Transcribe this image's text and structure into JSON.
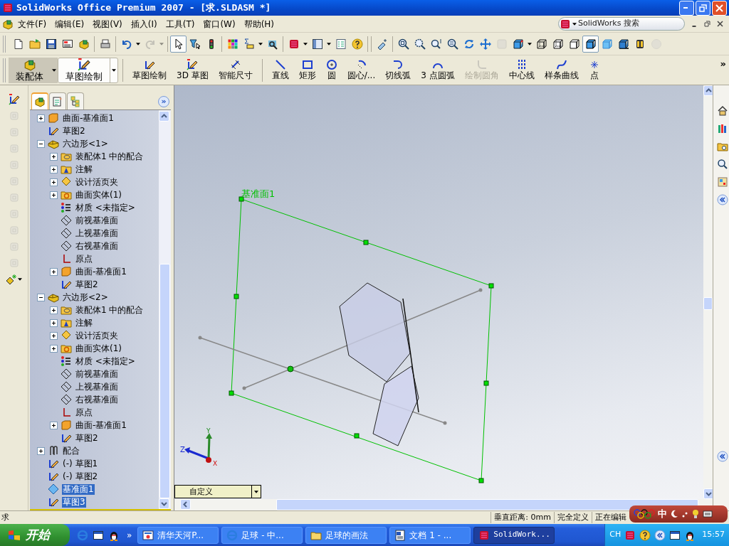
{
  "window": {
    "title": "SolidWorks Office Premium 2007 - [求.SLDASM *]"
  },
  "menu": [
    {
      "label": "文件(F)"
    },
    {
      "label": "编辑(E)"
    },
    {
      "label": "视图(V)"
    },
    {
      "label": "插入(I)"
    },
    {
      "label": "工具(T)"
    },
    {
      "label": "窗口(W)"
    },
    {
      "label": "帮助(H)"
    }
  ],
  "search": {
    "placeholder": "SolidWorks 搜索"
  },
  "toolbar": {
    "groups": [
      {
        "items": [
          {
            "kind": "new",
            "selected": false,
            "disabled": false
          },
          {
            "kind": "open",
            "selected": false,
            "disabled": false
          },
          {
            "kind": "save",
            "selected": false,
            "disabled": false
          },
          {
            "kind": "drawing",
            "selected": false,
            "disabled": false
          },
          {
            "kind": "assembly",
            "selected": false,
            "disabled": false
          }
        ]
      },
      {
        "items": [
          {
            "kind": "print",
            "selected": false,
            "disabled": false
          }
        ]
      },
      {
        "items": [
          {
            "kind": "undo",
            "selected": false,
            "disabled": false
          },
          {
            "kind": "caret",
            "selected": false,
            "disabled": false
          },
          {
            "kind": "redo",
            "selected": false,
            "disabled": true
          },
          {
            "kind": "caret",
            "selected": false,
            "disabled": true
          }
        ]
      },
      {
        "items": [
          {
            "kind": "select",
            "selected": true,
            "disabled": false
          },
          {
            "kind": "filter",
            "selected": false,
            "disabled": false
          },
          {
            "kind": "traffic",
            "selected": false,
            "disabled": false
          }
        ]
      },
      {
        "items": [
          {
            "kind": "palette",
            "selected": false,
            "disabled": false
          },
          {
            "kind": "equation",
            "selected": false,
            "disabled": false
          },
          {
            "kind": "caret",
            "selected": false,
            "disabled": false
          },
          {
            "kind": "sensor",
            "selected": false,
            "disabled": false
          }
        ]
      },
      {
        "items": [
          {
            "kind": "swlogo",
            "selected": false,
            "disabled": false
          },
          {
            "kind": "caret",
            "selected": false,
            "disabled": false
          },
          {
            "kind": "layout",
            "selected": false,
            "disabled": false
          },
          {
            "kind": "caret",
            "selected": false,
            "disabled": false
          },
          {
            "kind": "options",
            "selected": false,
            "disabled": false
          },
          {
            "kind": "help",
            "selected": false,
            "disabled": false
          }
        ]
      },
      {
        "items": [
          {
            "kind": "viewtool",
            "selected": false,
            "disabled": false
          }
        ]
      },
      {
        "items": [
          {
            "kind": "zoomfit",
            "selected": false,
            "disabled": false
          },
          {
            "kind": "zoomarea",
            "selected": false,
            "disabled": false
          },
          {
            "kind": "zoominout",
            "selected": false,
            "disabled": false
          },
          {
            "kind": "zoomsel",
            "selected": false,
            "disabled": false
          },
          {
            "kind": "rotate",
            "selected": false,
            "disabled": false
          },
          {
            "kind": "pan",
            "selected": false,
            "disabled": false
          },
          {
            "kind": "draw3d",
            "selected": false,
            "disabled": true
          },
          {
            "kind": "views",
            "selected": false,
            "disabled": false
          },
          {
            "kind": "caret",
            "selected": false,
            "disabled": false
          },
          {
            "kind": "wireframe",
            "selected": false,
            "disabled": false
          },
          {
            "kind": "hiddenvisible",
            "selected": false,
            "disabled": false
          },
          {
            "kind": "hiddenremoved",
            "selected": false,
            "disabled": false
          },
          {
            "kind": "shadededges",
            "selected": true,
            "disabled": false
          },
          {
            "kind": "shaded",
            "selected": false,
            "disabled": false
          },
          {
            "kind": "shadows",
            "selected": false,
            "disabled": false
          },
          {
            "kind": "section",
            "selected": false,
            "disabled": false
          },
          {
            "kind": "realview",
            "selected": false,
            "disabled": true
          }
        ]
      }
    ]
  },
  "command_manager": {
    "tabs": [
      {
        "label": "装配体",
        "kind": "assembly",
        "selected": false
      },
      {
        "label": "草图绘制",
        "kind": "sketch3d",
        "selected": true
      }
    ],
    "groups": [
      {
        "buttons": [
          {
            "label": "草图绘制",
            "kind": "sketch",
            "disabled": false
          },
          {
            "label": "3D 草图",
            "kind": "sketch3d",
            "disabled": false
          },
          {
            "label": "智能尺寸",
            "kind": "dimension",
            "disabled": false
          }
        ]
      },
      {
        "buttons": [
          {
            "label": "直线",
            "kind": "line",
            "disabled": false
          },
          {
            "label": "矩形",
            "kind": "rectangle",
            "disabled": false
          },
          {
            "label": "圆",
            "kind": "circle",
            "disabled": false
          },
          {
            "label": "圆心/...",
            "kind": "centerarc",
            "disabled": false
          },
          {
            "label": "切线弧",
            "kind": "tangentarc",
            "disabled": false
          },
          {
            "label": "3 点圆弧",
            "kind": "arc3",
            "disabled": false
          },
          {
            "label": "绘制圆角",
            "kind": "fillet",
            "disabled": true
          },
          {
            "label": "中心线",
            "kind": "centerline",
            "disabled": false
          },
          {
            "label": "样条曲线",
            "kind": "spline",
            "disabled": false
          },
          {
            "label": "点",
            "kind": "point",
            "disabled": false
          }
        ]
      }
    ],
    "more": "»"
  },
  "left_toolbar": [
    {
      "kind": "sketch3d",
      "disabled": false
    },
    {
      "kind": "tool",
      "disabled": true
    },
    {
      "kind": "tool",
      "disabled": true
    },
    {
      "kind": "tool",
      "disabled": true
    },
    {
      "kind": "tool",
      "disabled": true
    },
    {
      "kind": "tool",
      "disabled": true
    },
    {
      "kind": "tool",
      "disabled": true
    },
    {
      "kind": "tool",
      "disabled": true
    },
    {
      "kind": "tool",
      "disabled": true
    },
    {
      "kind": "tool",
      "disabled": true
    },
    {
      "kind": "tool",
      "disabled": true
    },
    {
      "kind": "planestar",
      "disabled": false
    }
  ],
  "feature_tree": {
    "tabs": [
      {
        "kind": "assembly",
        "selected": true
      },
      {
        "kind": "property",
        "selected": false
      },
      {
        "kind": "config",
        "selected": false
      }
    ],
    "more": "»",
    "items": [
      {
        "children": [
          {
            "label": "曲面-基准面1",
            "kind": "surface",
            "expanded": false,
            "selected": false
          },
          {
            "label": "草图2",
            "kind": "sketch",
            "selected": false
          }
        ]
      },
      {
        "label": "六边形<1>",
        "kind": "part",
        "expanded": true,
        "selected": false,
        "children": [
          {
            "label": "装配体1 中的配合",
            "kind": "mates",
            "expanded": false,
            "selected": false
          },
          {
            "label": "注解",
            "kind": "annotations",
            "expanded": false,
            "selected": false
          },
          {
            "label": "设计活页夹",
            "kind": "design",
            "expanded": false,
            "selected": false
          },
          {
            "label": "曲面实体(1)",
            "kind": "solid",
            "expanded": false,
            "selected": false
          },
          {
            "label": "材质 <未指定>",
            "kind": "material",
            "selected": false
          },
          {
            "label": "前视基准面",
            "kind": "plane",
            "selected": false
          },
          {
            "label": "上视基准面",
            "kind": "plane",
            "selected": false
          },
          {
            "label": "右视基准面",
            "kind": "plane",
            "selected": false
          },
          {
            "label": "原点",
            "kind": "origin",
            "selected": false
          },
          {
            "label": "曲面-基准面1",
            "kind": "surface",
            "expanded": false,
            "selected": false
          },
          {
            "label": "草图2",
            "kind": "sketch",
            "selected": false
          }
        ]
      },
      {
        "label": "六边形<2>",
        "kind": "part",
        "expanded": true,
        "selected": false,
        "children": [
          {
            "label": "装配体1 中的配合",
            "kind": "mates",
            "expanded": false,
            "selected": false
          },
          {
            "label": "注解",
            "kind": "annotations",
            "expanded": false,
            "selected": false
          },
          {
            "label": "设计活页夹",
            "kind": "design",
            "expanded": false,
            "selected": false
          },
          {
            "label": "曲面实体(1)",
            "kind": "solid",
            "expanded": false,
            "selected": false
          },
          {
            "label": "材质 <未指定>",
            "kind": "material",
            "selected": false
          },
          {
            "label": "前视基准面",
            "kind": "plane",
            "selected": false
          },
          {
            "label": "上视基准面",
            "kind": "plane",
            "selected": false
          },
          {
            "label": "右视基准面",
            "kind": "plane",
            "selected": false
          },
          {
            "label": "原点",
            "kind": "origin",
            "selected": false
          },
          {
            "label": "曲面-基准面1",
            "kind": "surface",
            "expanded": false,
            "selected": false
          },
          {
            "label": "草图2",
            "kind": "sketch",
            "selected": false
          }
        ]
      },
      {
        "label": "配合",
        "kind": "mategroup",
        "expanded": false,
        "selected": false
      },
      {
        "label": "(-) 草图1",
        "kind": "sketch",
        "selected": false
      },
      {
        "label": "(-) 草图2",
        "kind": "sketch",
        "selected": false
      },
      {
        "label": "基准面1",
        "kind": "planesel",
        "selected": true
      },
      {
        "label": "草图3",
        "kind": "sketch",
        "selected": true
      }
    ]
  },
  "canvas": {
    "plane_label": "基准面1",
    "axes": {
      "x": "X",
      "y": "Y",
      "z": "Z"
    },
    "view_dropdown": "自定义"
  },
  "status_bar": {
    "message": "求",
    "fields": [
      "垂直距离: 0mm",
      "完全定义",
      "正在编辑"
    ]
  },
  "ime_bar": {
    "label": "中"
  },
  "taskbar": {
    "start": "开始",
    "quick_launch_more": "»",
    "tasks": [
      {
        "label": "清华天河P...",
        "kind": "tianhe",
        "selected": false
      },
      {
        "label": "足球 - 中...",
        "kind": "ie",
        "selected": false
      },
      {
        "label": "足球的画法",
        "kind": "folder",
        "selected": false
      },
      {
        "label": "文档 1 - ...",
        "kind": "word",
        "selected": false
      },
      {
        "label": "SolidWork...",
        "kind": "swlogo",
        "selected": true
      }
    ],
    "language": "CH",
    "clock": "15:57"
  }
}
